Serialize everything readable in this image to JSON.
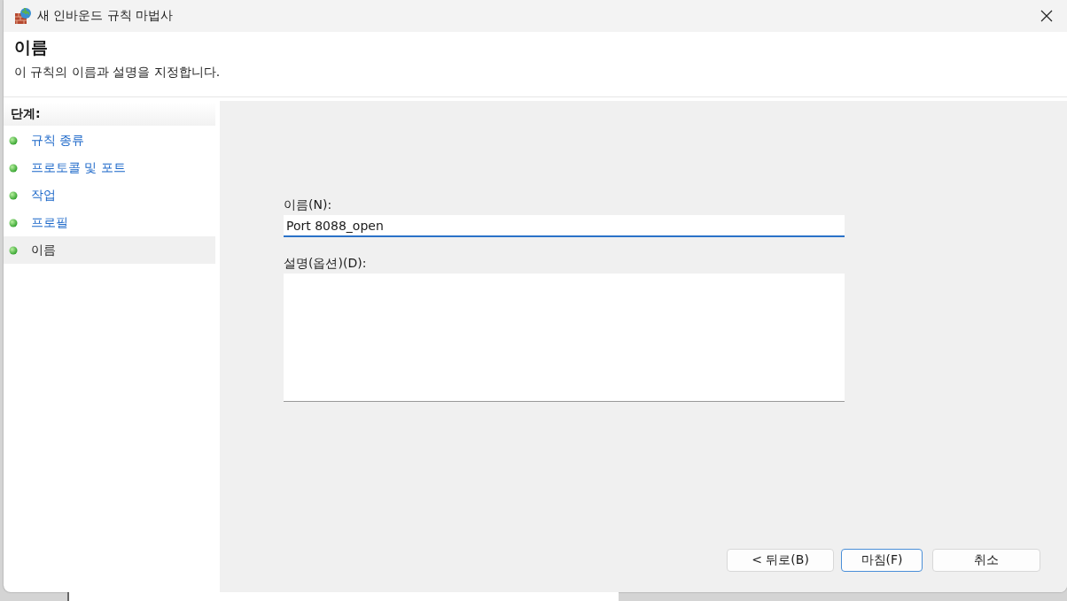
{
  "window": {
    "title": "새 인바운드 규칙 마법사"
  },
  "header": {
    "title": "이름",
    "description": "이 규칙의 이름과 설명을 지정합니다."
  },
  "steps": {
    "heading": "단계:",
    "items": [
      {
        "label": "규칙 종류",
        "selected": false
      },
      {
        "label": "프로토콜 및 포트",
        "selected": false
      },
      {
        "label": "작업",
        "selected": false
      },
      {
        "label": "프로필",
        "selected": false
      },
      {
        "label": "이름",
        "selected": true
      }
    ]
  },
  "form": {
    "name_label": "이름(N):",
    "name_value": "Port 8088_open",
    "description_label": "설명(옵션)(D):"
  },
  "buttons": [
    {
      "label": "< 뒤로(B)",
      "kind": "normal"
    },
    {
      "label": "마침(F)",
      "kind": "default"
    },
    {
      "label": "취소",
      "kind": "normal"
    }
  ]
}
